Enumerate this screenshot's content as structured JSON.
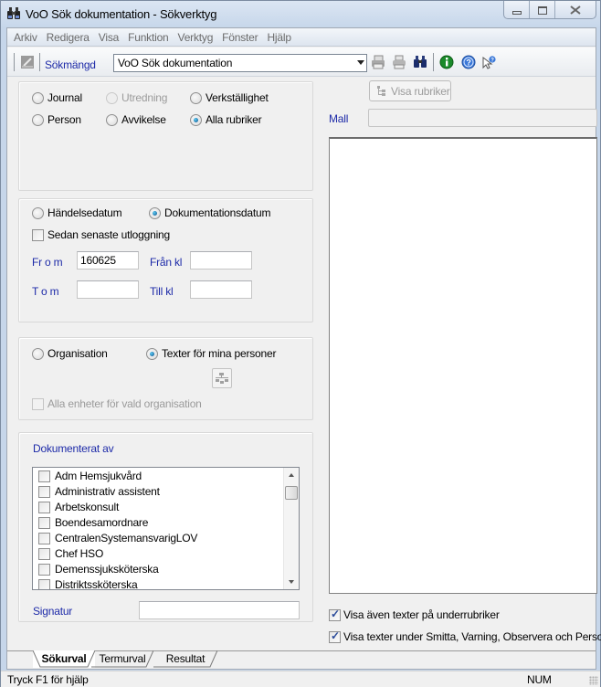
{
  "window": {
    "title": "VoO Sök dokumentation - Sökverktyg",
    "controls": [
      "minimize",
      "maximize",
      "close"
    ]
  },
  "menu": [
    "Arkiv",
    "Redigera",
    "Visa",
    "Funktion",
    "Verktyg",
    "Fönster",
    "Hjälp"
  ],
  "toolbar": {
    "sokmangd_label": "Sökmängd",
    "sokmangd_value": "VoO Sök dokumentation",
    "icons": [
      "edit-icon",
      "print-preview-icon",
      "print-icon",
      "binoculars-icon",
      "info-icon",
      "help-icon",
      "whats-this-icon"
    ]
  },
  "rubriker": {
    "options": [
      {
        "label": "Journal",
        "checked": false,
        "enabled": true
      },
      {
        "label": "Utredning",
        "checked": false,
        "enabled": false
      },
      {
        "label": "Verkställighet",
        "checked": false,
        "enabled": true
      },
      {
        "label": "Person",
        "checked": false,
        "enabled": true
      },
      {
        "label": "Avvikelse",
        "checked": false,
        "enabled": true
      },
      {
        "label": "Alla rubriker",
        "checked": true,
        "enabled": true
      }
    ]
  },
  "datum": {
    "options": [
      {
        "label": "Händelsedatum",
        "checked": false
      },
      {
        "label": "Dokumentationsdatum",
        "checked": true
      }
    ],
    "sedan_senaste": {
      "label": "Sedan senaste utloggning",
      "checked": false
    },
    "from_label": "Fr o m",
    "from_value": "160625",
    "fran_kl_label": "Från kl",
    "fran_kl_value": "",
    "tom_label": "T o m",
    "tom_value": "",
    "till_kl_label": "Till kl",
    "till_kl_value": ""
  },
  "urval": {
    "options": [
      {
        "label": "Organisation",
        "checked": false
      },
      {
        "label": "Texter för mina personer",
        "checked": true
      }
    ],
    "alla_enheter": {
      "label": "Alla enheter för vald organisation",
      "checked": false,
      "enabled": false
    }
  },
  "dokumenterat": {
    "title": "Dokumenterat av",
    "items": [
      {
        "label": "Adm Hemsjukvård",
        "checked": false
      },
      {
        "label": "Administrativ assistent",
        "checked": false
      },
      {
        "label": "Arbetskonsult",
        "checked": false
      },
      {
        "label": "Boendesamordnare",
        "checked": false
      },
      {
        "label": "CentralenSystemansvarigLOV",
        "checked": false
      },
      {
        "label": "Chef HSO",
        "checked": false
      },
      {
        "label": "Demenssjuksköterska",
        "checked": false
      },
      {
        "label": "Distriktssköterska",
        "checked": false
      }
    ],
    "signatur_label": "Signatur",
    "signatur_value": ""
  },
  "right": {
    "visa_rubriker_label": "Visa rubriker",
    "mall_label": "Mall",
    "mall_value": "",
    "text_content": "",
    "underrubriker": {
      "label": "Visa även texter på underrubriker",
      "checked": true
    },
    "smitta": {
      "label": "Visa texter under Smitta, Varning, Observera och Person",
      "checked": true
    }
  },
  "tabs": [
    {
      "label": "Sökurval",
      "active": true
    },
    {
      "label": "Termurval",
      "active": false
    },
    {
      "label": "Resultat",
      "active": false
    }
  ],
  "status": {
    "help_text": "Tryck F1 för hjälp",
    "num": "NUM"
  }
}
